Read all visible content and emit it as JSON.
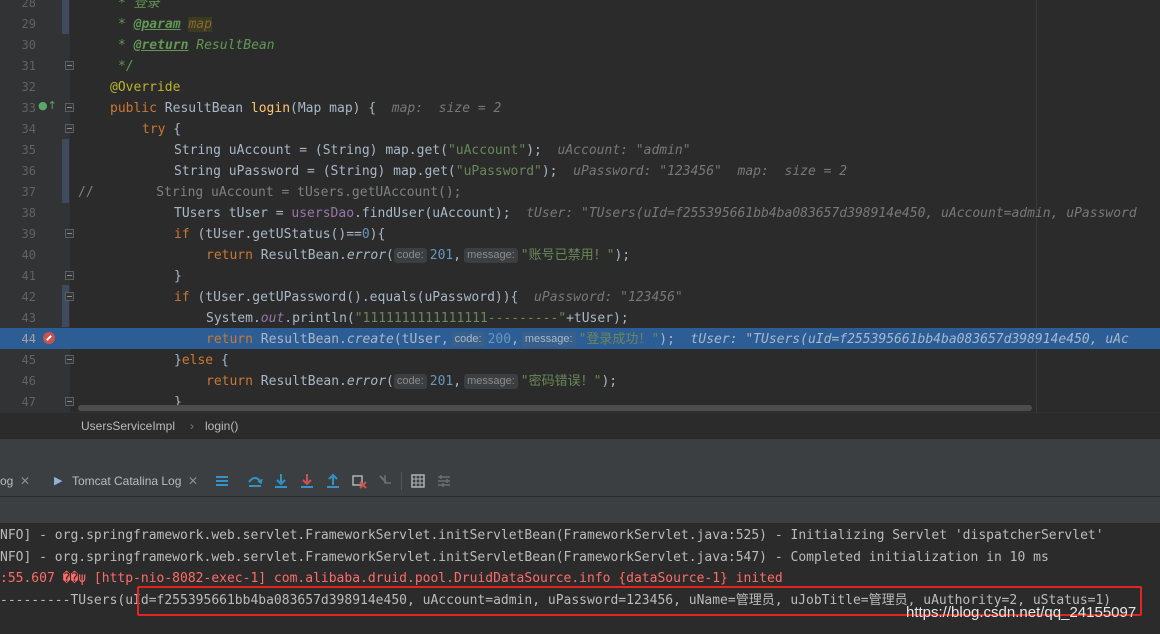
{
  "editor": {
    "line_numbers": [
      "28",
      "29",
      "30",
      "31",
      "32",
      "33",
      "34",
      "35",
      "36",
      "37",
      "38",
      "39",
      "40",
      "41",
      "42",
      "43",
      "44",
      "45",
      "46",
      "47"
    ],
    "current_line": "44",
    "l28": {
      "c1": "* 登录"
    },
    "l29": {
      "c1": "* ",
      "tag": "@param",
      "sp": " ",
      "name": "map"
    },
    "l30": {
      "c1": "* ",
      "tag": "@return",
      "rest": " ResultBean"
    },
    "l31": {
      "c1": "*/"
    },
    "l32": {
      "ann": "@Override"
    },
    "l33": {
      "kw": "public ",
      "t": "ResultBean ",
      "fn": "login",
      "rest": "(Map map) {",
      "dbg": "  map:  size = 2"
    },
    "l34": {
      "kw": "try",
      "rest": " {"
    },
    "l35": {
      "a": "String uAccount = (String) map.get(",
      "s": "\"uAccount\"",
      "b": ");",
      "dbg": "  uAccount: \"admin\""
    },
    "l36": {
      "a": "String uPassword = (String) map.get(",
      "s": "\"uPassword\"",
      "b": ");",
      "dbg": "  uPassword: \"123456\"  map:  size = 2"
    },
    "l37": {
      "a": "//",
      "b": "        String uAccount = tUsers.getUAccount();"
    },
    "l38": {
      "a": "TUsers tUser = ",
      "f": "usersDao",
      "b": ".findUser(uAccount);",
      "dbg": "  tUser: \"TUsers(uId=f255395661bb4ba083657d398914e450, uAccount=admin, uPassword"
    },
    "l39": {
      "kw": "if",
      "a": " (tUser.getUStatus()==",
      "n": "0",
      "b": "){"
    },
    "l40": {
      "kw": "return",
      "a": " ResultBean.",
      "m": "error",
      "b": "(",
      "h1": "code:",
      "n": "201",
      "c": ",",
      "h2": "message:",
      "s": "\"账号已禁用！\"",
      "e": ");"
    },
    "l41": {
      "a": "}"
    },
    "l42": {
      "kw": "if",
      "a": " (tUser.getUPassword().equals(uPassword)){",
      "dbg": "  uPassword: \"123456\""
    },
    "l43": {
      "a": "System.",
      "f": "out",
      "b": ".println(",
      "s": "\"1111111111111111---------\"",
      "e": "+tUser);"
    },
    "l44": {
      "kw": "return",
      "a": " ResultBean.",
      "m": "create",
      "b": "(tUser,",
      "h1": "code:",
      "n": "200",
      "c": ",",
      "h2": "message:",
      "s": "\"登录成功！\"",
      "e": ");",
      "dbg": "  tUser: \"TUsers(uId=f255395661bb4ba083657d398914e450, uAc"
    },
    "l45": {
      "a": "}",
      "kw": "else",
      "b": " {"
    },
    "l46": {
      "kw": "return",
      "a": " ResultBean.",
      "m": "error",
      "b": "(",
      "h1": "code:",
      "n": "201",
      "c": ",",
      "h2": "message:",
      "s": "\"密码错误！\"",
      "e": ");"
    },
    "l47": {
      "a": "}"
    }
  },
  "breadcrumb": {
    "class_name": "UsersServiceImpl",
    "sep": "›",
    "method_name": "login()"
  },
  "toolbar": {
    "tab_log_label": "og",
    "tab_tomcat_label": "Tomcat Catalina Log",
    "close_glyph": "✕",
    "icons": [
      "menu-icon",
      "step-over-icon",
      "step-into-icon",
      "force-step-into-icon",
      "step-out-icon",
      "drop-frame-icon",
      "run-to-cursor-icon",
      "evaluate-icon",
      "trace-icon"
    ]
  },
  "console": {
    "lines": [
      "NFO] - org.springframework.web.servlet.FrameworkServlet.initServletBean(FrameworkServlet.java:525) - Initializing Servlet 'dispatcherServlet'",
      "NFO] - org.springframework.web.servlet.FrameworkServlet.initServletBean(FrameworkServlet.java:547) - Completed initialization in 10 ms",
      ":55.607 ��ψ [http-nio-8082-exec-1] com.alibaba.druid.pool.DruidDataSource.info {dataSource-1} inited",
      "---------TUsers(uId=f255395661bb4ba083657d398914e450, uAccount=admin, uPassword=123456, uName=管理员, uJobTitle=管理员, uAuthority=2, uStatus=1)"
    ],
    "watermark": "https://blog.csdn.net/qq_24155097"
  },
  "colors": {
    "highlight": "#2d5d95",
    "annotation_box": "#e0261f",
    "breakpoint": "#c75450"
  }
}
